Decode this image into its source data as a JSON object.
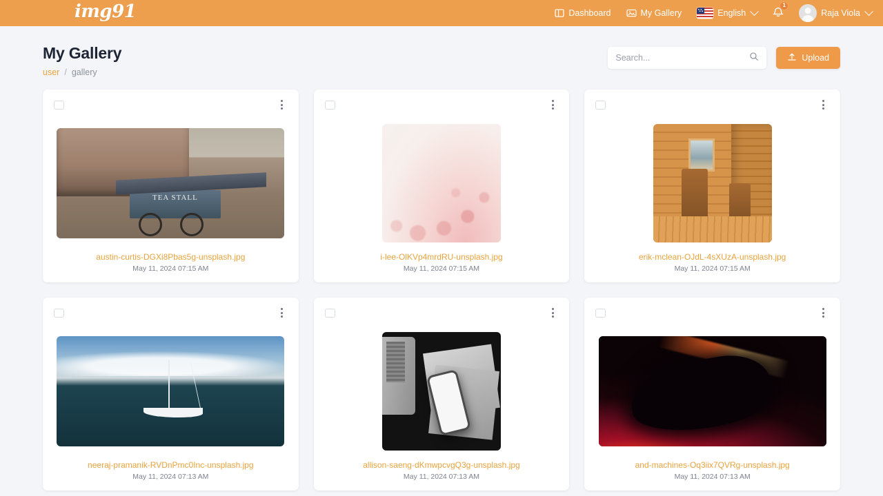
{
  "header": {
    "logo": "img91",
    "nav": [
      {
        "label": "Dashboard",
        "icon": "dashboard-icon"
      },
      {
        "label": "My Gallery",
        "icon": "gallery-icon"
      }
    ],
    "language": {
      "label": "English",
      "flag": "us-flag-icon"
    },
    "notifications": {
      "icon": "bell-icon",
      "count": "1"
    },
    "user": {
      "name": "Raja Viola",
      "avatar": "user-avatar"
    }
  },
  "page": {
    "title": "My Gallery",
    "breadcrumb": {
      "root": "user",
      "separator": "/",
      "current": "gallery"
    }
  },
  "toolbar": {
    "search_placeholder": "Search...",
    "search_value": "",
    "search_icon": "search-icon",
    "upload_label": "Upload",
    "upload_icon": "upload-icon"
  },
  "colors": {
    "brand_orange": "#ee9f4e",
    "link_orange": "#e8a33d",
    "page_bg": "#f4f5f9",
    "card_bg": "#ffffff",
    "title_text": "#1d2433",
    "muted_text": "#7d838f"
  },
  "gallery": {
    "items": [
      {
        "filename": "austin-curtis-DGXi8Pbas5g-unsplash.jpg",
        "date": "May 11, 2024 07:15 AM",
        "art": "art-teastall",
        "shape": "landscape"
      },
      {
        "filename": "i-lee-OlKVp4mrdRU-unsplash.jpg",
        "date": "May 11, 2024 07:15 AM",
        "art": "art-blossom",
        "shape": "square"
      },
      {
        "filename": "erik-mclean-OJdL-4sXUzA-unsplash.jpg",
        "date": "May 11, 2024 07:15 AM",
        "art": "art-cabin",
        "shape": "square"
      },
      {
        "filename": "neeraj-pramanik-RVDnPmc0Inc-unsplash.jpg",
        "date": "May 11, 2024 07:13 AM",
        "art": "art-boat",
        "shape": "landscape"
      },
      {
        "filename": "allison-saeng-dKmwpcvgQ3g-unsplash.jpg",
        "date": "May 11, 2024 07:13 AM",
        "art": "art-flat",
        "shape": "square"
      },
      {
        "filename": "and-machines-Oq3iix7QVRg-unsplash.jpg",
        "date": "May 11, 2024 07:13 AM",
        "art": "art-swirl",
        "shape": "landscape"
      }
    ]
  }
}
